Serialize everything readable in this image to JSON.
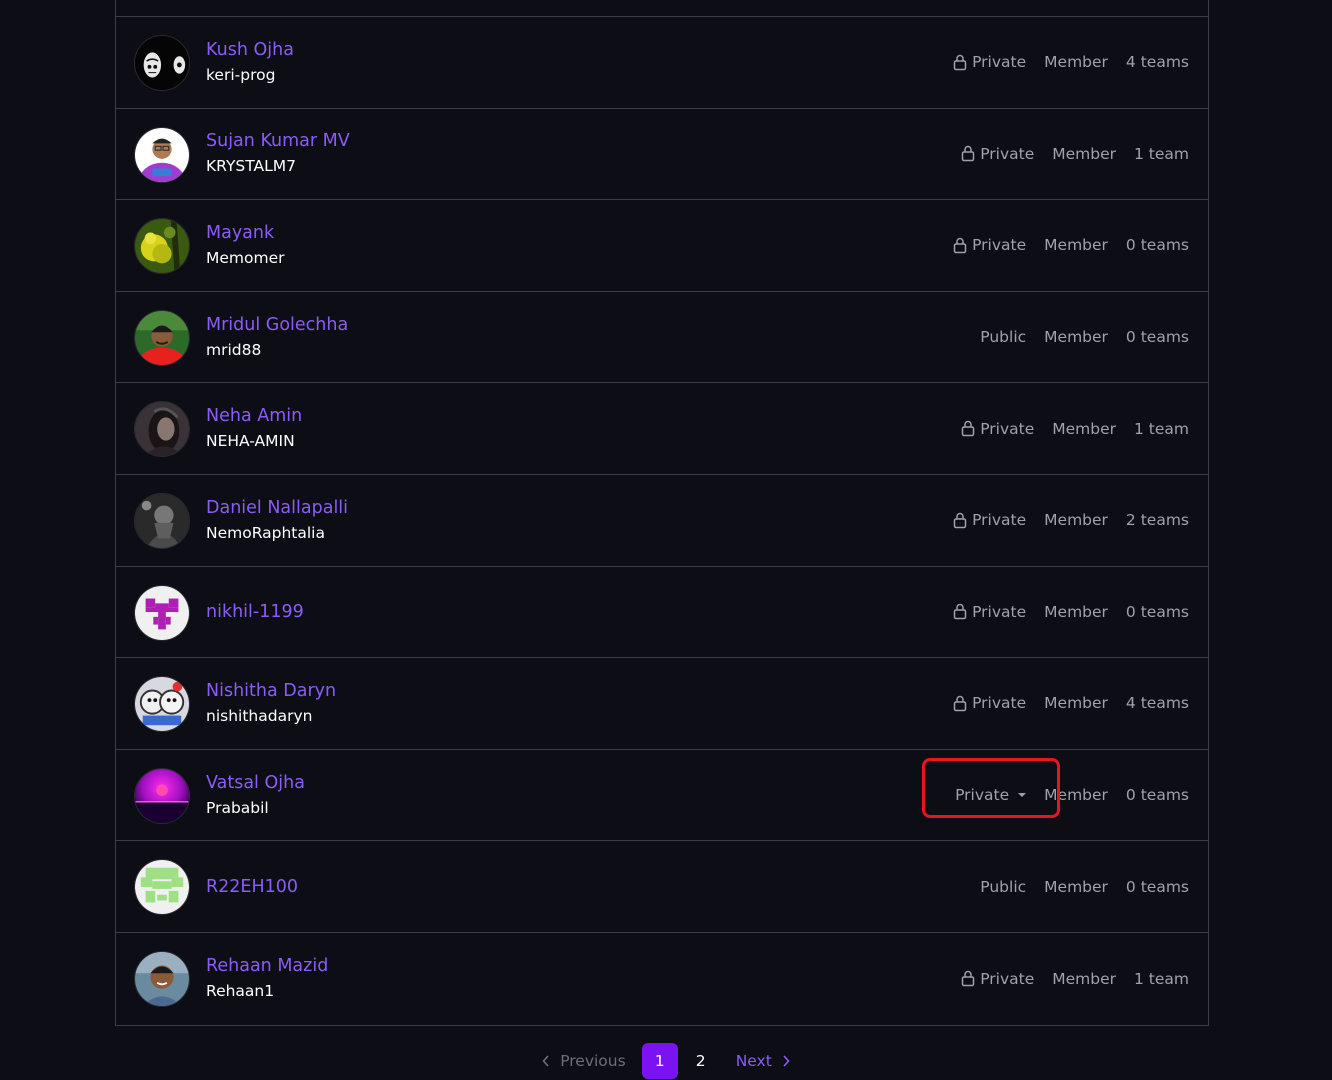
{
  "members": [
    {
      "name": "Kush Ojha",
      "login": "keri-prog",
      "visibility": "Private",
      "role": "Member",
      "teams": "4 teams",
      "locked": true,
      "avatar": "kush"
    },
    {
      "name": "Sujan Kumar MV",
      "login": "KRYSTALM7",
      "visibility": "Private",
      "role": "Member",
      "teams": "1 team",
      "locked": true,
      "avatar": "sujan"
    },
    {
      "name": "Mayank",
      "login": "Memomer",
      "visibility": "Private",
      "role": "Member",
      "teams": "0 teams",
      "locked": true,
      "avatar": "mayank"
    },
    {
      "name": "Mridul Golechha",
      "login": "mrid88",
      "visibility": "Public",
      "role": "Member",
      "teams": "0 teams",
      "locked": false,
      "avatar": "mridul"
    },
    {
      "name": "Neha Amin",
      "login": "NEHA-AMIN",
      "visibility": "Private",
      "role": "Member",
      "teams": "1 team",
      "locked": true,
      "avatar": "neha"
    },
    {
      "name": "Daniel Nallapalli",
      "login": "NemoRaphtalia",
      "visibility": "Private",
      "role": "Member",
      "teams": "2 teams",
      "locked": true,
      "avatar": "daniel"
    },
    {
      "name": "nikhil-1199",
      "login": "",
      "visibility": "Private",
      "role": "Member",
      "teams": "0 teams",
      "locked": true,
      "avatar": "nikhil"
    },
    {
      "name": "Nishitha Daryn",
      "login": "nishithadaryn",
      "visibility": "Private",
      "role": "Member",
      "teams": "4 teams",
      "locked": true,
      "avatar": "nishitha"
    },
    {
      "name": "Vatsal Ojha",
      "login": "Prababil",
      "visibility": "Private",
      "role": "Member",
      "teams": "0 teams",
      "locked": true,
      "avatar": "vatsal",
      "dropdown": true
    },
    {
      "name": "R22EH100",
      "login": "",
      "visibility": "Public",
      "role": "Member",
      "teams": "0 teams",
      "locked": false,
      "avatar": "r22"
    },
    {
      "name": "Rehaan Mazid",
      "login": "Rehaan1",
      "visibility": "Private",
      "role": "Member",
      "teams": "1 team",
      "locked": true,
      "avatar": "rehaan"
    }
  ],
  "pagination": {
    "previous": "Previous",
    "pages": [
      "1",
      "2"
    ],
    "current": "1",
    "next": "Next"
  },
  "colors": {
    "accent": "#8b5cf6",
    "current_page": "#7a12f2",
    "highlight": "#e8141e"
  }
}
